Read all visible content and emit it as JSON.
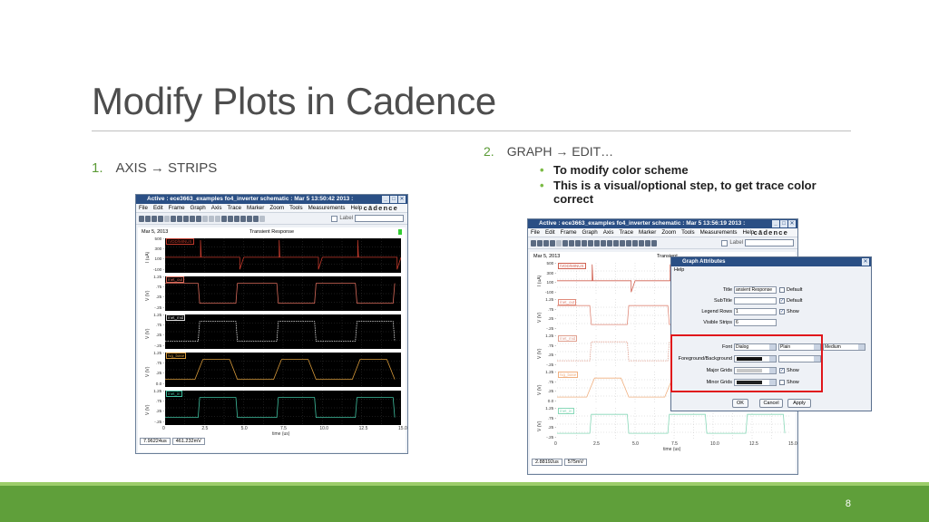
{
  "slide": {
    "title": "Modify Plots in Cadence",
    "page_number": "8",
    "step1": {
      "num": "1.",
      "text": "AXIS → STRIPS"
    },
    "step2": {
      "num": "2.",
      "text": "GRAPH → EDIT…"
    },
    "bullets": [
      "To modify color scheme",
      "This is a visual/optional step, to get trace color correct"
    ]
  },
  "window1": {
    "title": "Active : ece3663_examples fo4_inverter schematic : Mar  5 13:50:42 2013 :",
    "menus": [
      "File",
      "Edit",
      "Frame",
      "Graph",
      "Axis",
      "Trace",
      "Marker",
      "Zoom",
      "Tools",
      "Measurements",
      "Help"
    ],
    "brand": "cādence",
    "label_text": "Label",
    "date": "Mar 5, 2013",
    "plot_title": "Transient Response",
    "strips": [
      {
        "name": "/VDD/MINUS",
        "ylabel": "I (uA)",
        "ticks": [
          "500",
          "300",
          "100",
          "-100"
        ]
      },
      {
        "name": "/net_out",
        "ylabel": "V (V)",
        "ticks": [
          "1.25",
          ".75",
          ".25",
          "-.25"
        ]
      },
      {
        "name": "/net_mid",
        "ylabel": "V (V)",
        "ticks": [
          "1.25",
          ".75",
          ".25",
          "-.25"
        ]
      },
      {
        "name": "/vg_base",
        "ylabel": "V (V)",
        "ticks": [
          "1.25",
          ".75",
          ".25",
          "0.0"
        ]
      },
      {
        "name": "/net_in",
        "ylabel": "V (V)",
        "ticks": [
          "1.25",
          ".75",
          ".25",
          "-.25"
        ]
      }
    ],
    "xticks": [
      "0",
      "2.5",
      "5.0",
      "7.5",
      "10.0",
      "12.5",
      "15.0"
    ],
    "xlabel": "time (us)",
    "status": [
      "7.96224us",
      "461.232mV"
    ]
  },
  "window2": {
    "title": "Active : ece3663_examples fo4_inverter schematic : Mar  5 13:56:19 2013 :",
    "menus": [
      "File",
      "Edit",
      "Frame",
      "Graph",
      "Axis",
      "Trace",
      "Marker",
      "Zoom",
      "Tools",
      "Measurements",
      "Help"
    ],
    "brand": "cādence",
    "label_text": "Label",
    "date": "Mar 5, 2013",
    "plot_title": "Transient",
    "strips": [
      {
        "name": "/VDD/MINUS",
        "ylabel": "I (uA)",
        "ticks": [
          "500",
          "300",
          "100",
          "-100"
        ]
      },
      {
        "name": "/net_out",
        "ylabel": "V (V)",
        "ticks": [
          "1.25",
          ".75",
          ".25",
          "-.25"
        ]
      },
      {
        "name": "/net_mid",
        "ylabel": "V (V)",
        "ticks": [
          "1.25",
          ".75",
          ".25",
          "-.25"
        ]
      },
      {
        "name": "/vg_base",
        "ylabel": "V (V)",
        "ticks": [
          "1.25",
          ".75",
          ".25",
          "0.0"
        ]
      },
      {
        "name": "/net_in",
        "ylabel": "V (V)",
        "ticks": [
          "1.25",
          ".75",
          ".25",
          "-.25"
        ]
      }
    ],
    "xticks": [
      "0",
      "2.5",
      "5.0",
      "7.5",
      "10.0",
      "12.5",
      "15.0"
    ],
    "xlabel": "time (us)",
    "status": [
      "2.88192us",
      "575mV"
    ]
  },
  "dialog": {
    "title": "Graph Attributes",
    "menu": "Help",
    "title_label": "Title",
    "title_value": "ansient Response",
    "title_default": "Default",
    "subtitle_label": "SubTitle",
    "subtitle_default": "Default",
    "legend_rows_label": "Legend Rows",
    "legend_rows_value": "1",
    "legend_show": "Show",
    "visible_strips_label": "Visible Strips",
    "visible_strips_value": "6",
    "font_label": "Font",
    "font_family": "Dialog",
    "font_style": "Plain",
    "font_size": "Medium",
    "fgbg_label": "Foreground/Background",
    "major_label": "Major Grids",
    "major_show": "Show",
    "minor_label": "Minor Grids",
    "minor_show": "Show",
    "ok": "OK",
    "cancel": "Cancel",
    "apply": "Apply"
  },
  "colors": {
    "green_accent": "#5f9f3a",
    "highlight_red": "#e0161b",
    "window_title": "#2a4f85"
  }
}
